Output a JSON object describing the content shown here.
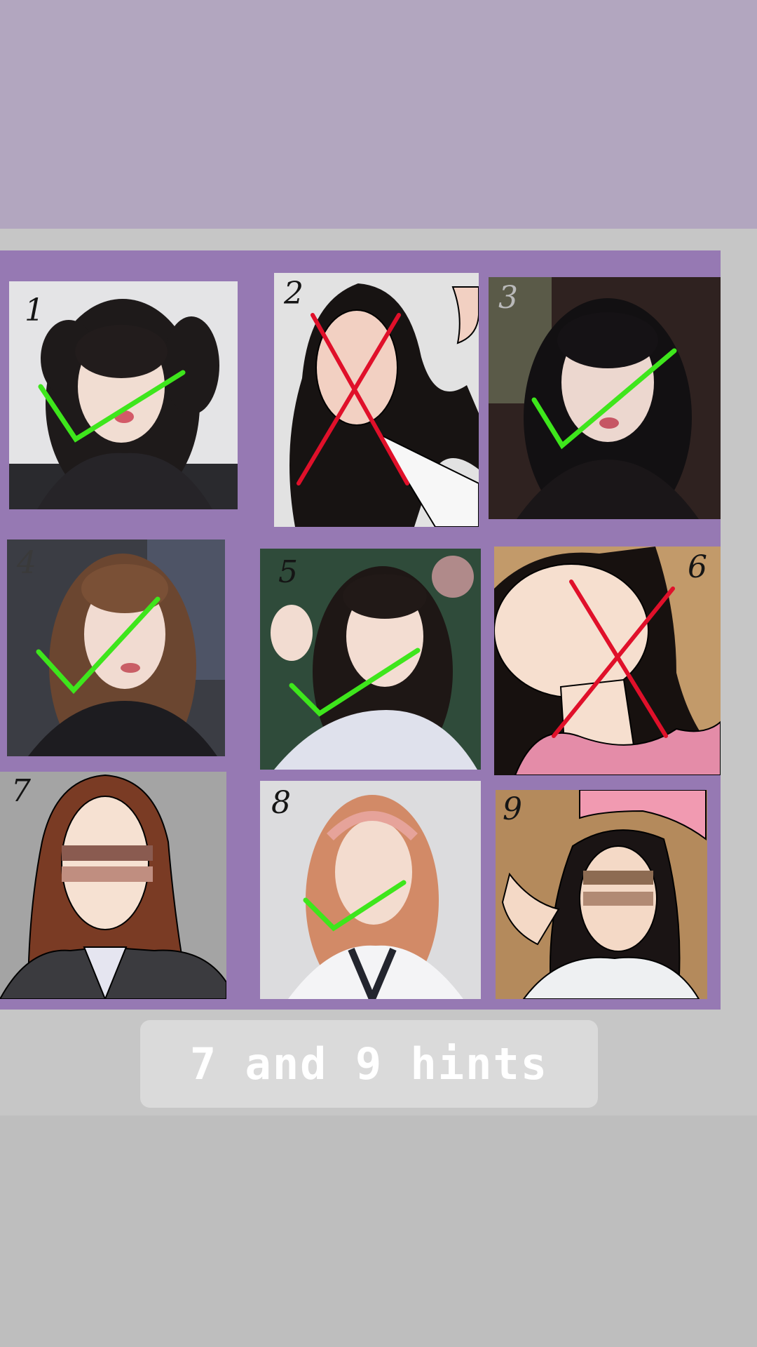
{
  "story": {
    "caption": "7 and 9 hints"
  },
  "grid": {
    "cells": [
      {
        "number": "1",
        "type": "photo",
        "mark": "check"
      },
      {
        "number": "2",
        "type": "drawing",
        "mark": "cross"
      },
      {
        "number": "3",
        "type": "photo",
        "mark": "check"
      },
      {
        "number": "4",
        "type": "photo",
        "mark": "check"
      },
      {
        "number": "5",
        "type": "photo",
        "mark": "check"
      },
      {
        "number": "6",
        "type": "drawing",
        "mark": "cross"
      },
      {
        "number": "7",
        "type": "drawing-hint",
        "mark": "none"
      },
      {
        "number": "8",
        "type": "photo",
        "mark": "check"
      },
      {
        "number": "9",
        "type": "drawing-hint",
        "mark": "none"
      }
    ]
  },
  "colors": {
    "board": "#9679b3",
    "check": "#3ee61c",
    "cross": "#e0102a",
    "top_band": "#b2a6bf"
  }
}
